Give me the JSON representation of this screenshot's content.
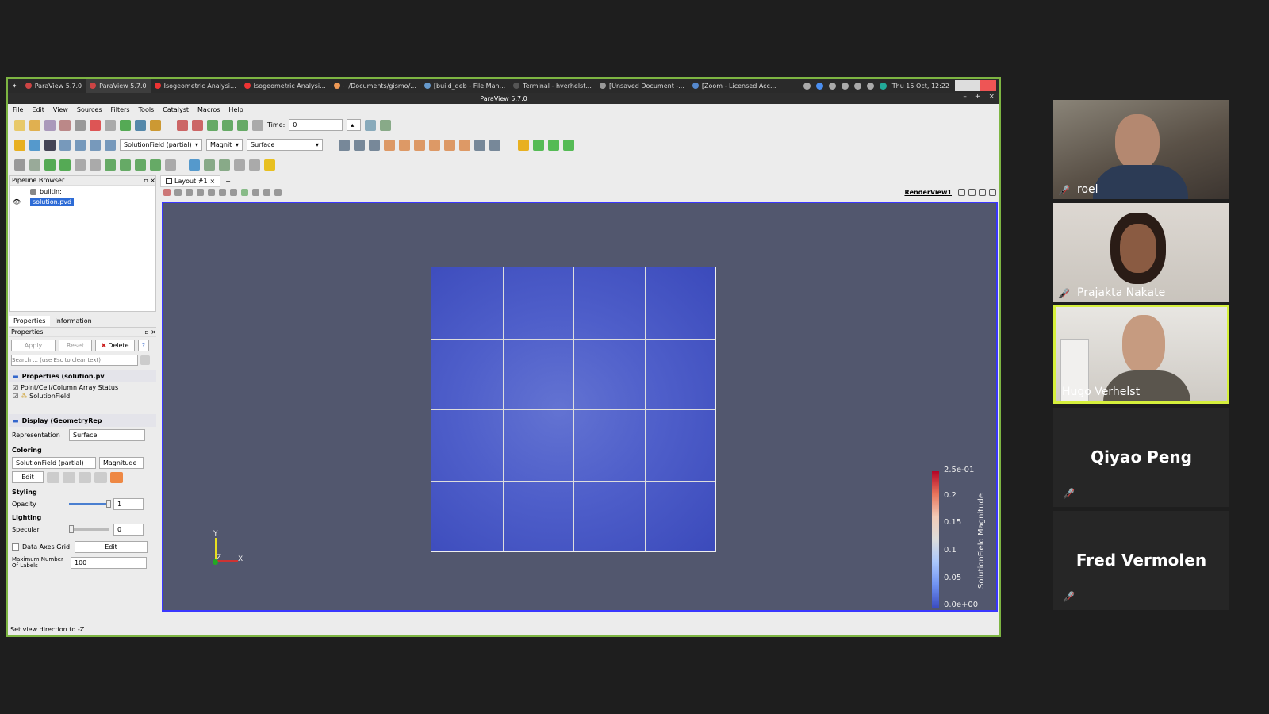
{
  "taskbar": {
    "items": [
      {
        "label": "ParaView 5.7.0",
        "active": false,
        "color": "#c44"
      },
      {
        "label": "ParaView 5.7.0",
        "active": true,
        "color": "#c44"
      },
      {
        "label": "Isogeometric Analysi...",
        "active": false,
        "color": "#e33"
      },
      {
        "label": "Isogeometric Analysi...",
        "active": false,
        "color": "#e33"
      },
      {
        "label": "~/Documents/gismo/...",
        "active": false,
        "color": "#e95"
      },
      {
        "label": "[build_deb - File Man...",
        "active": false,
        "color": "#69c"
      },
      {
        "label": "Terminal - hverhelst...",
        "active": false,
        "color": "#555"
      },
      {
        "label": "[Unsaved Document -...",
        "active": false,
        "color": "#999"
      },
      {
        "label": "[Zoom - Licensed Acc...",
        "active": false,
        "color": "#58c"
      }
    ],
    "clock": "Thu 15 Oct, 12:22"
  },
  "window": {
    "title": "ParaView 5.7.0"
  },
  "menu": [
    "File",
    "Edit",
    "View",
    "Sources",
    "Filters",
    "Tools",
    "Catalyst",
    "Macros",
    "Help"
  ],
  "toolbar": {
    "time_label": "Time:",
    "time_value": "0",
    "array_combo": "SolutionField (partial)",
    "component_combo": "Magnit",
    "repr_combo": "Surface"
  },
  "pipeline": {
    "title": "Pipeline Browser",
    "builtin": "builtin:",
    "item": "solution.pvd"
  },
  "props": {
    "tab_properties": "Properties",
    "tab_information": "Information",
    "title": "Properties",
    "apply": "Apply",
    "reset": "Reset",
    "delete": "Delete",
    "help": "?",
    "search_placeholder": "Search ... (use Esc to clear text)",
    "section_props": "Properties (solution.pv",
    "array_status": "Point/Cell/Column Array Status",
    "solution_field": "SolutionField",
    "section_display": "Display (GeometryRep",
    "representation_label": "Representation",
    "representation_value": "Surface",
    "coloring": "Coloring",
    "coloring_array": "SolutionField (partial)",
    "coloring_component": "Magnitude",
    "edit": "Edit",
    "styling": "Styling",
    "opacity_label": "Opacity",
    "opacity_value": "1",
    "lighting": "Lighting",
    "specular_label": "Specular",
    "specular_value": "0",
    "data_axes_grid": "Data Axes Grid",
    "data_axes_edit": "Edit",
    "max_labels_label": "Maximum Number Of Labels",
    "max_labels_value": "100"
  },
  "view": {
    "layout_tab": "Layout #1",
    "add_tab": "+",
    "render_view": "RenderView1",
    "axes": {
      "y": "Y",
      "z": "Z",
      "x": "X"
    },
    "colorbar": {
      "title": "SolutionField Magnitude",
      "ticks": [
        "2.5e-01",
        "0.2",
        "0.15",
        "0.1",
        "0.05",
        "0.0e+00"
      ]
    }
  },
  "status": "Set view direction to -Z",
  "participants": [
    {
      "name": "roel",
      "type": "video",
      "muted": true,
      "highlight": false
    },
    {
      "name": "Prajakta Nakate",
      "type": "video",
      "muted": true,
      "highlight": false
    },
    {
      "name": "Hugo Verhelst",
      "type": "video",
      "muted": false,
      "highlight": true
    },
    {
      "name": "Qiyao Peng",
      "type": "card",
      "muted": true
    },
    {
      "name": "Fred Vermolen",
      "type": "card",
      "muted": true
    }
  ]
}
